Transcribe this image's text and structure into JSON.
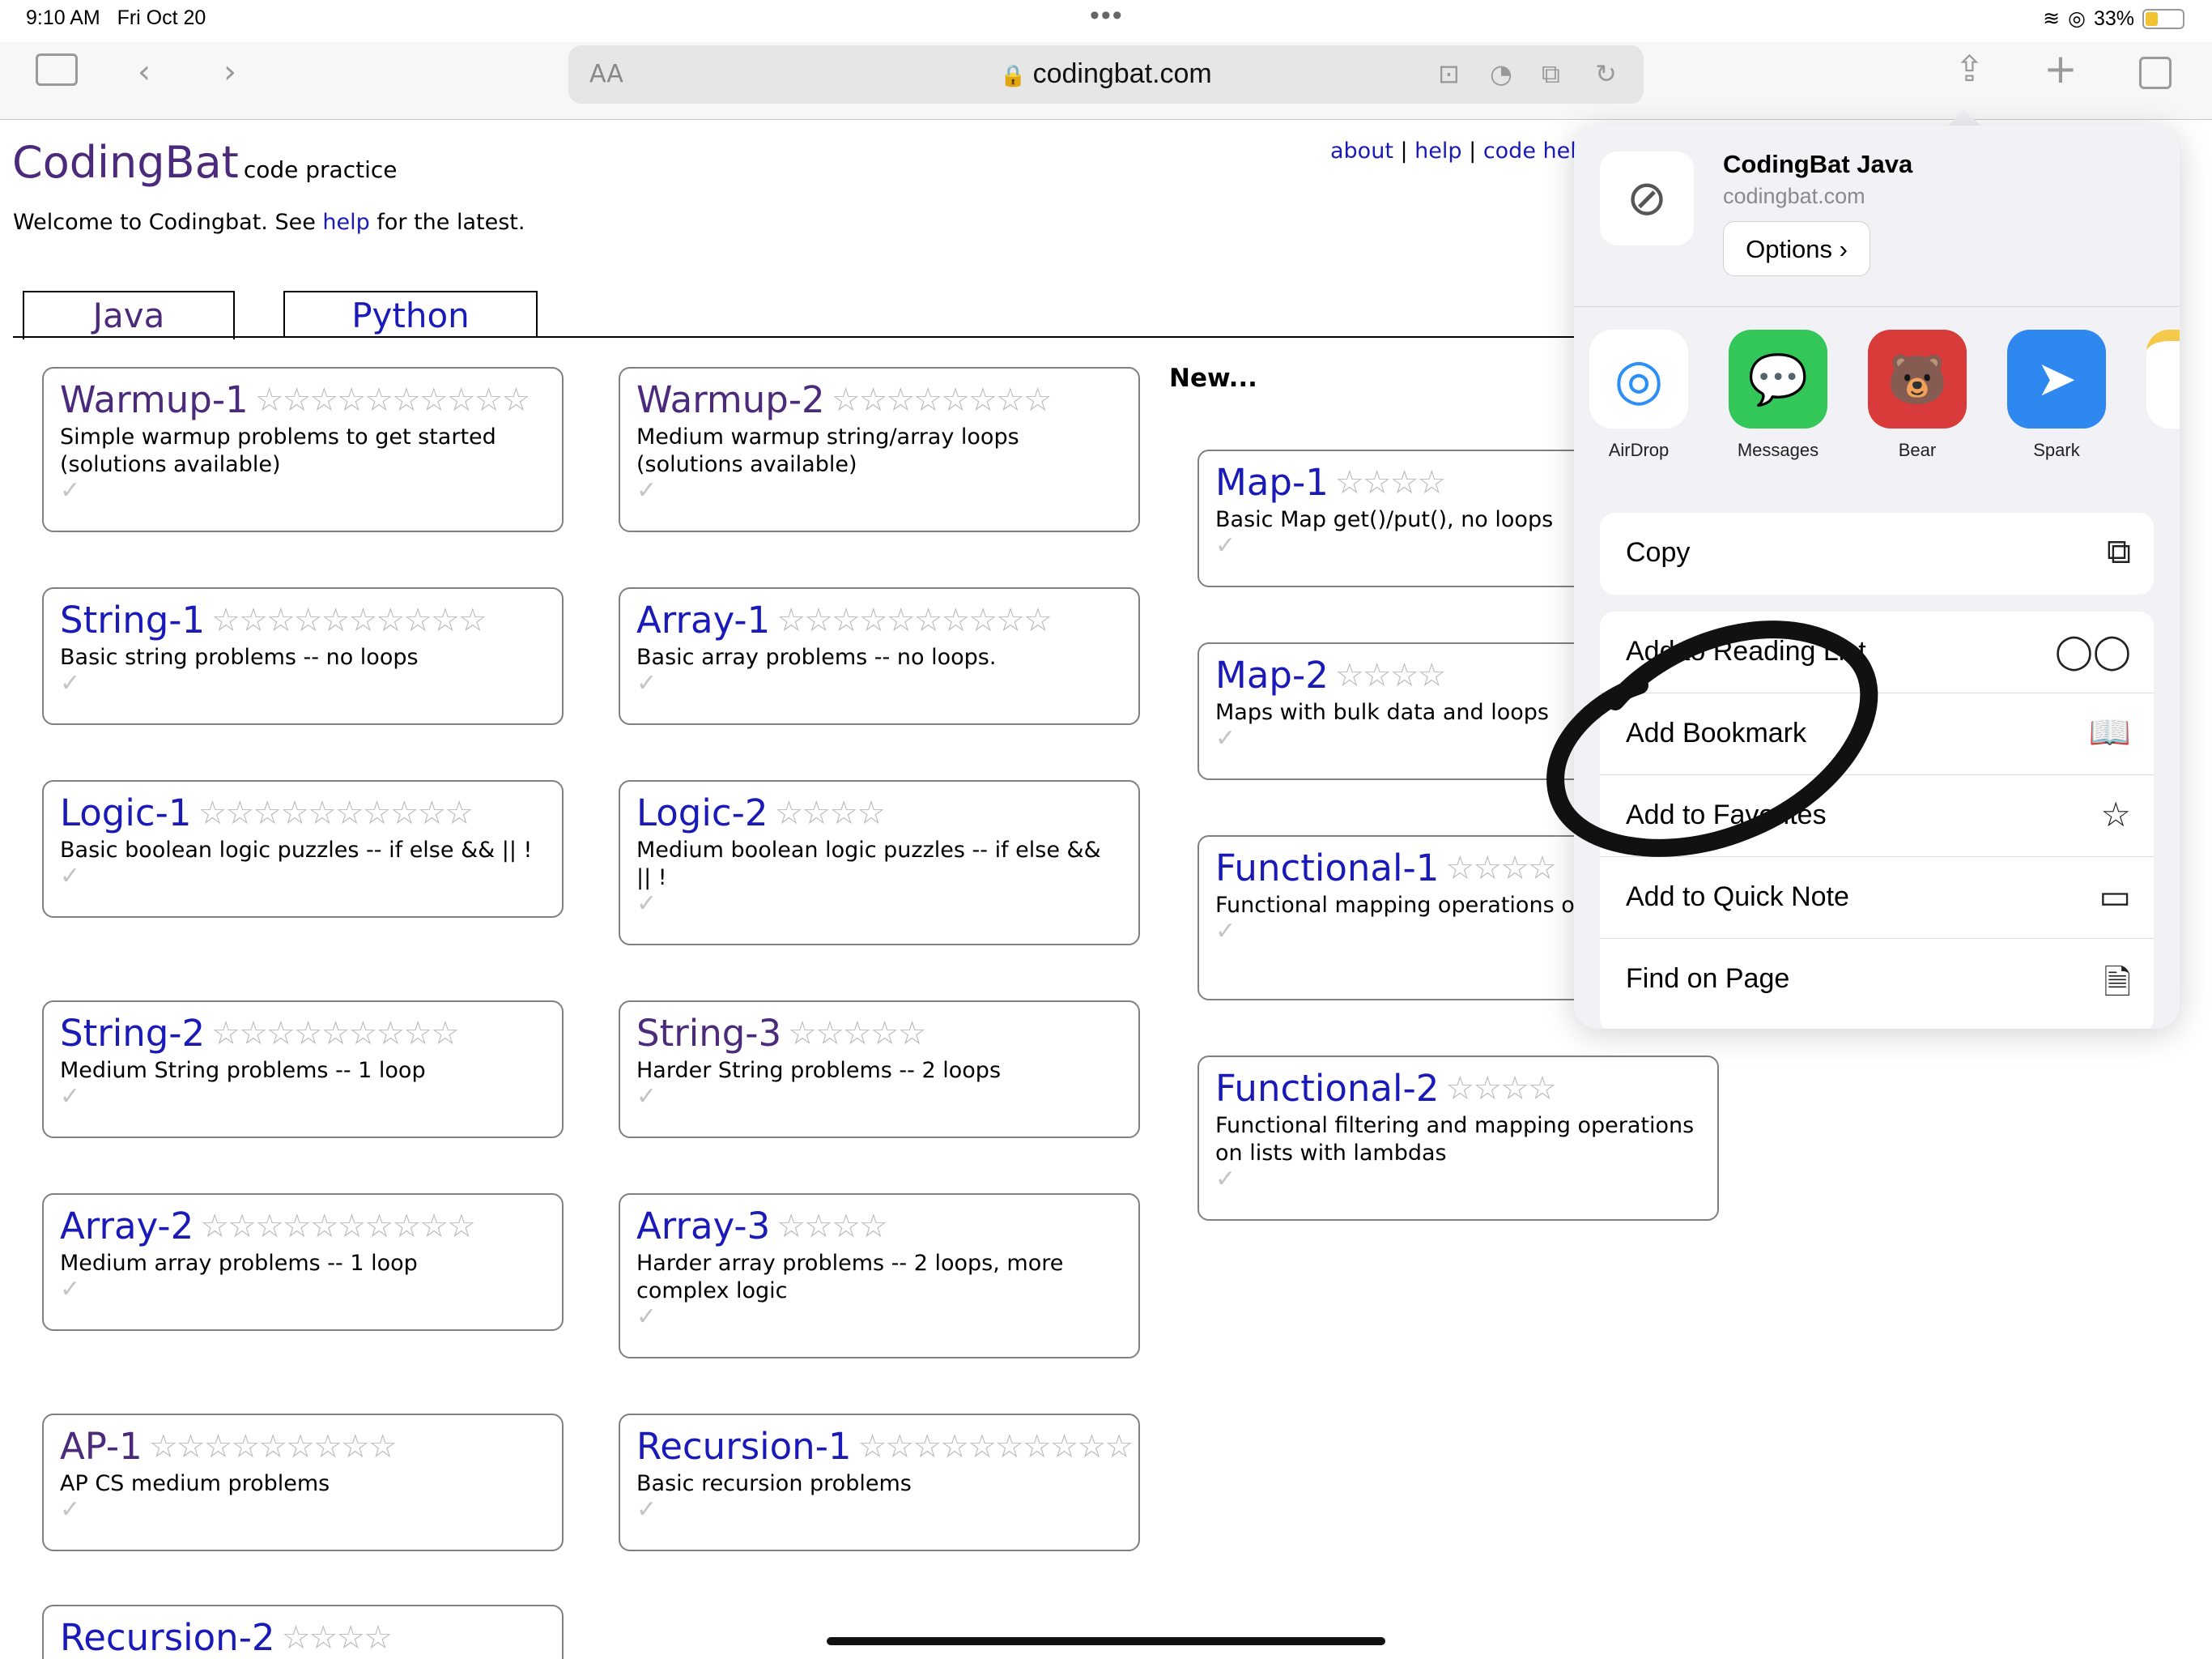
{
  "status": {
    "time": "9:10 AM",
    "date": "Fri Oct 20",
    "battery": "33%"
  },
  "toolbar": {
    "aa": "AA",
    "url": "codingbat.com"
  },
  "header": {
    "logo": "CodingBat",
    "logo_sub": "code practice",
    "welcome_pre": "Welcome to Codingbat. See ",
    "welcome_link": "help",
    "welcome_post": " for the latest.",
    "links": [
      "about",
      "help",
      "code hel"
    ]
  },
  "tabs": [
    "Java",
    "Python"
  ],
  "new_label": "New...",
  "cards": [
    {
      "title": "Warmup-1",
      "stars": "☆☆☆☆☆☆☆☆☆☆",
      "desc": "Simple warmup problems to get started (solutions available)"
    },
    {
      "title": "Warmup-2",
      "stars": "☆☆☆☆☆☆☆☆",
      "desc": "Medium warmup string/array loops (solutions available)"
    },
    {
      "title": "String-1",
      "stars": "☆☆☆☆☆☆☆☆☆☆",
      "desc": "Basic string problems -- no loops"
    },
    {
      "title": "Array-1",
      "stars": "☆☆☆☆☆☆☆☆☆☆",
      "desc": "Basic array problems -- no loops."
    },
    {
      "title": "Logic-1",
      "stars": "☆☆☆☆☆☆☆☆☆☆",
      "desc": "Basic boolean logic puzzles -- if else && || !"
    },
    {
      "title": "Logic-2",
      "stars": "☆☆☆☆",
      "desc": "Medium boolean logic puzzles -- if else && || !"
    },
    {
      "title": "String-2",
      "stars": "☆☆☆☆☆☆☆☆☆",
      "desc": "Medium String problems -- 1 loop"
    },
    {
      "title": "String-3",
      "stars": "☆☆☆☆☆",
      "desc": "Harder String problems -- 2 loops"
    },
    {
      "title": "Array-2",
      "stars": "☆☆☆☆☆☆☆☆☆☆",
      "desc": "Medium array problems -- 1 loop"
    },
    {
      "title": "Array-3",
      "stars": "☆☆☆☆",
      "desc": "Harder array problems -- 2 loops, more complex logic"
    },
    {
      "title": "AP-1",
      "stars": "☆☆☆☆☆☆☆☆☆",
      "desc": "AP CS medium problems"
    },
    {
      "title": "Recursion-1",
      "stars": "☆☆☆☆☆☆☆☆☆☆",
      "desc": "Basic recursion problems"
    },
    {
      "title": "Recursion-2",
      "stars": "☆☆☆☆",
      "desc": ""
    },
    {
      "title": "Map-1",
      "stars": "☆☆☆☆",
      "desc": "Basic Map get()/put(), no loops"
    },
    {
      "title": "Map-2",
      "stars": "☆☆☆☆",
      "desc": "Maps with bulk data and loops"
    },
    {
      "title": "Functional-1",
      "stars": "☆☆☆☆",
      "desc": "Functional mapping operations on lambdas"
    },
    {
      "title": "Functional-2",
      "stars": "☆☆☆☆",
      "desc": "Functional filtering and mapping operations on lists with lambdas"
    }
  ],
  "check": "✓",
  "share": {
    "title": "CodingBat Java",
    "url": "codingbat.com",
    "options": "Options",
    "apps": [
      "AirDrop",
      "Messages",
      "Bear",
      "Spark"
    ],
    "actions": [
      "Copy",
      "Add to Reading List",
      "Add Bookmark",
      "Add to Favorites",
      "Add to Quick Note",
      "Find on Page"
    ]
  },
  "colors": {
    "link": "#1a1ab8",
    "visited": "#4b2a7b",
    "airdrop": "#2b8ff5",
    "messages": "#33c759",
    "bear": "#d93a3a",
    "spark": "#2f88ef"
  }
}
